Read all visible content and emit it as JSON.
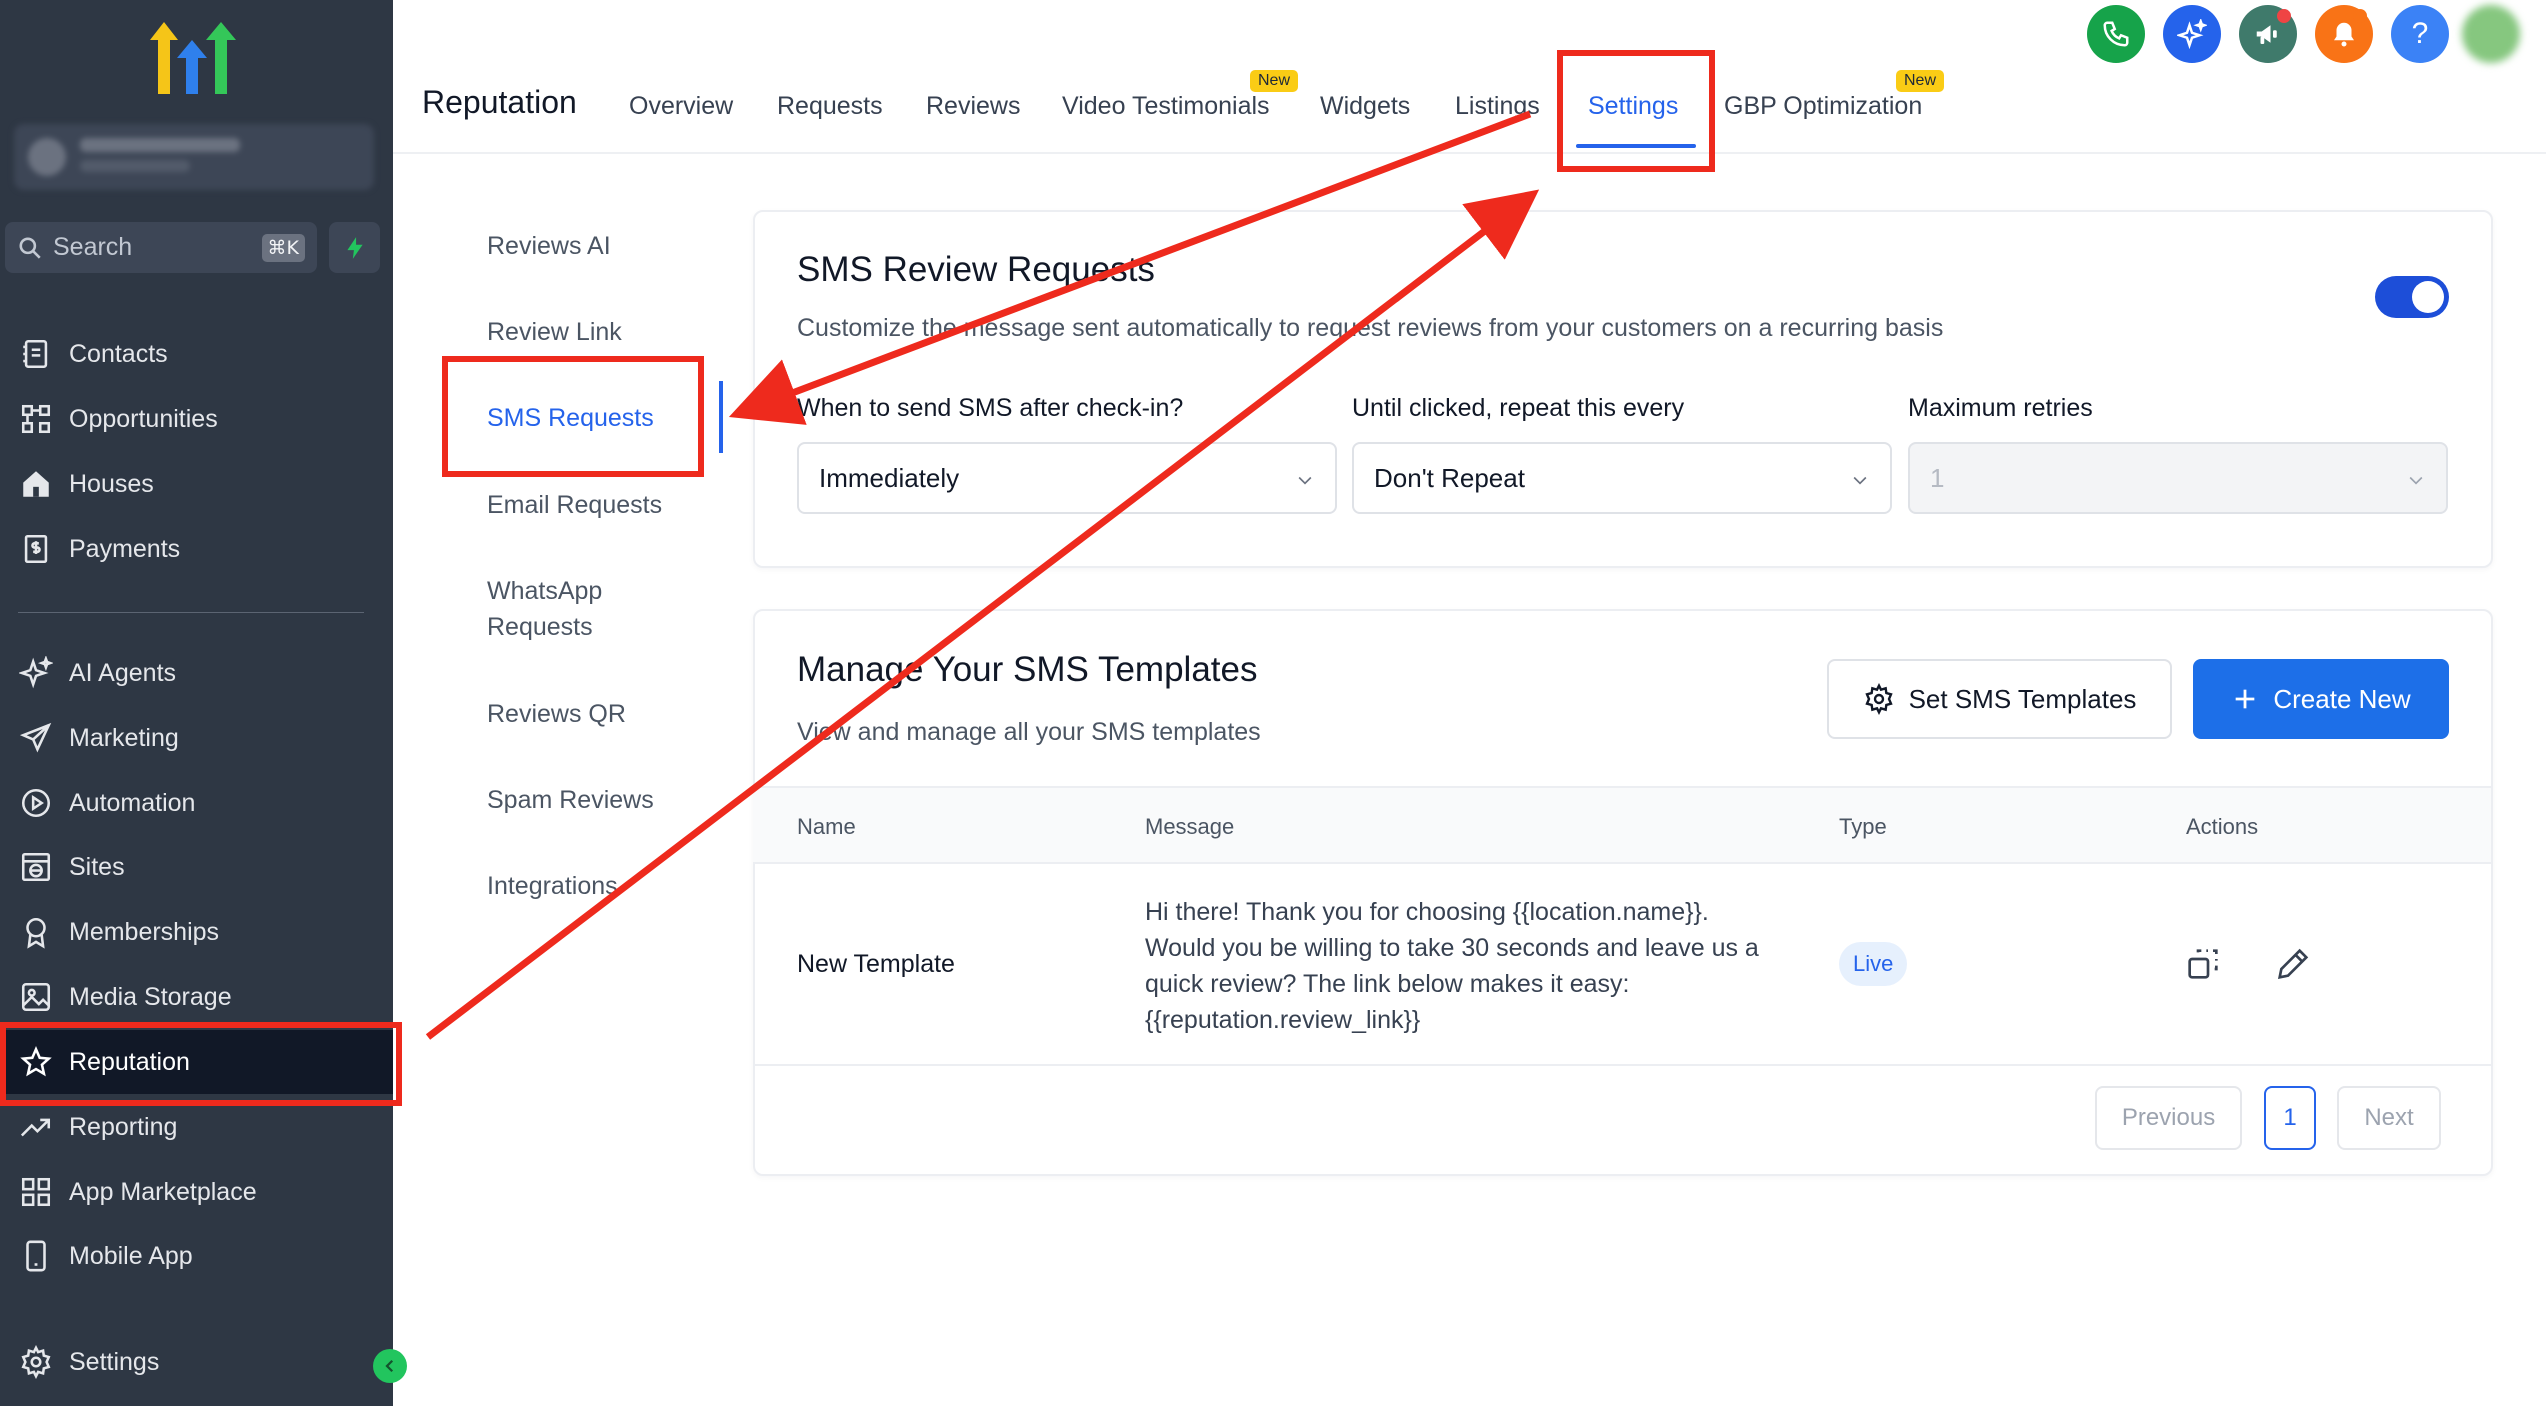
{
  "sidebar": {
    "search": {
      "label": "Search",
      "shortcut": "⌘K"
    },
    "items": [
      {
        "label": "Contacts",
        "icon": "contacts-icon"
      },
      {
        "label": "Opportunities",
        "icon": "opportunities-icon"
      },
      {
        "label": "Houses",
        "icon": "house-icon"
      },
      {
        "label": "Payments",
        "icon": "payments-icon"
      },
      {
        "label": "AI Agents",
        "icon": "sparkle-icon"
      },
      {
        "label": "Marketing",
        "icon": "send-icon"
      },
      {
        "label": "Automation",
        "icon": "play-circle-icon"
      },
      {
        "label": "Sites",
        "icon": "globe-icon"
      },
      {
        "label": "Memberships",
        "icon": "award-icon"
      },
      {
        "label": "Media Storage",
        "icon": "image-icon"
      },
      {
        "label": "Reputation",
        "icon": "star-icon"
      },
      {
        "label": "Reporting",
        "icon": "trend-icon"
      },
      {
        "label": "App Marketplace",
        "icon": "grid-icon"
      },
      {
        "label": "Mobile App",
        "icon": "phone-icon"
      }
    ],
    "settings": "Settings"
  },
  "header": {
    "title": "Reputation",
    "tabs": [
      {
        "label": "Overview"
      },
      {
        "label": "Requests"
      },
      {
        "label": "Reviews"
      },
      {
        "label": "Video Testimonials",
        "badge": "New"
      },
      {
        "label": "Widgets"
      },
      {
        "label": "Listings"
      },
      {
        "label": "Settings",
        "active": true
      },
      {
        "label": "GBP Optimization",
        "badge": "New"
      }
    ],
    "help_label": "?"
  },
  "subnav": {
    "items": [
      {
        "label": "Reviews AI"
      },
      {
        "label": "Review Link"
      },
      {
        "label": "SMS Requests",
        "active": true
      },
      {
        "label": "Email Requests"
      },
      {
        "label": "WhatsApp Requests"
      },
      {
        "label": "Reviews QR"
      },
      {
        "label": "Spam Reviews"
      },
      {
        "label": "Integrations"
      }
    ]
  },
  "sms_review_requests": {
    "title": "SMS Review Requests",
    "description": "Customize the message sent automatically to request reviews from your customers on a recurring basis",
    "enabled": true,
    "fields": [
      {
        "label": "When to send SMS after check-in?",
        "value": "Immediately"
      },
      {
        "label": "Until clicked, repeat this every",
        "value": "Don't Repeat"
      },
      {
        "label": "Maximum retries",
        "value": "1",
        "disabled": true
      }
    ]
  },
  "templates": {
    "title": "Manage Your SMS Templates",
    "description": "View and manage all your SMS templates",
    "set_button": "Set SMS Templates",
    "create_button": "Create New",
    "columns": [
      "Name",
      "Message",
      "Type",
      "Actions"
    ],
    "rows": [
      {
        "name": "New Template",
        "message": "Hi there! Thank you for choosing {{location.name}}. Would you be willing to take 30 seconds and leave us a quick review? The link below makes it easy: {{reputation.review_link}}",
        "type": "Live"
      }
    ],
    "pagination": {
      "previous": "Previous",
      "current": "1",
      "next": "Next"
    }
  },
  "colors": {
    "sidebar_bg": "#2e3744",
    "accent": "#2563eb",
    "primary_button": "#1d6fe8",
    "annotation": "#ee2a1d",
    "new_badge": "#facc15"
  }
}
